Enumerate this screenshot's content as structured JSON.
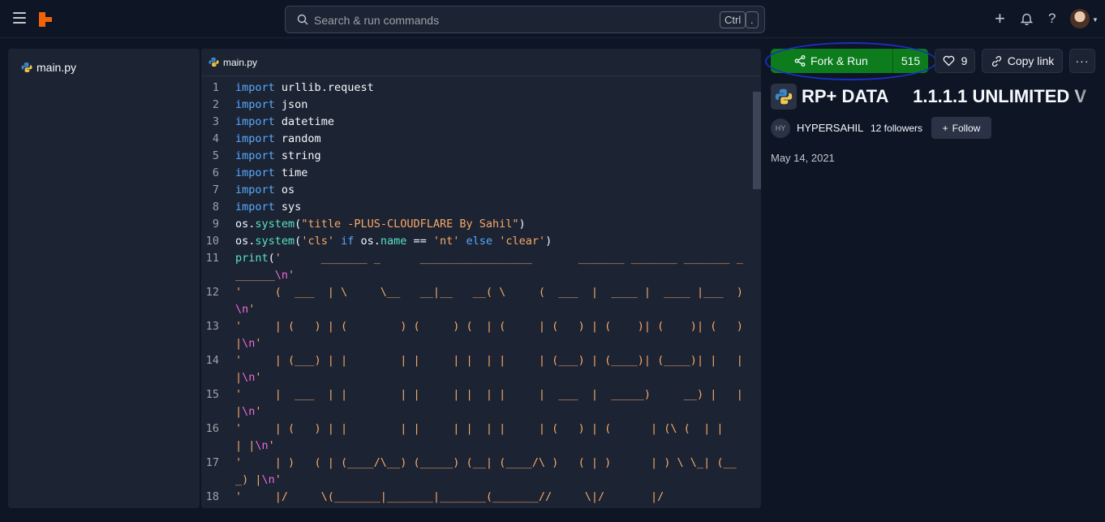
{
  "topbar": {
    "search_placeholder": "Search & run commands",
    "kbd_ctrl": "Ctrl",
    "kbd_dot": ".",
    "add_symbol": "+",
    "help_symbol": "?"
  },
  "filetree": {
    "file_name": "main.py"
  },
  "editor": {
    "tab_label": "main.py",
    "lines": [
      {
        "n": "1"
      },
      {
        "n": "2"
      },
      {
        "n": "3"
      },
      {
        "n": "4"
      },
      {
        "n": "5"
      },
      {
        "n": "6"
      },
      {
        "n": "7"
      },
      {
        "n": "8"
      },
      {
        "n": "9"
      },
      {
        "n": "10"
      },
      {
        "n": "11"
      },
      {
        "n": "12"
      },
      {
        "n": "13"
      },
      {
        "n": "14"
      },
      {
        "n": "15"
      },
      {
        "n": "16"
      },
      {
        "n": "17"
      },
      {
        "n": "18"
      }
    ],
    "code": {
      "l1": "urllib.request",
      "l2": "json",
      "l3": "datetime",
      "l4": "random",
      "l5": "string",
      "l6": "time",
      "l7": "os",
      "l8": "sys",
      "kw_import": "import",
      "l9_obj": "os.",
      "l9_fn": "system",
      "l9_open": "(",
      "l9_str": "\"title -PLUS-CLOUDFLARE By Sahil\"",
      "l9_close": ")",
      "l10_obj": "os.",
      "l10_fn": "system",
      "l10_open": "(",
      "l10_str1": "'cls'",
      "l10_if": " if ",
      "l10_mid": "os.",
      "l10_name": "name",
      "l10_eq": " == ",
      "l10_str2": "'nt'",
      "l10_else": " else ",
      "l10_str3": "'clear'",
      "l10_close": ")",
      "l11_fn": "print",
      "l11_open": "(",
      "l11_str": "'      _______ _      _________________       _______ _______ _______ _______",
      "l12_str": "'     (  ___  | \\     \\__   __|__   __( \\     (  ___  |  ____ |  ____ |___  )",
      "l13_str": "'     | (   ) | (        ) (     ) (  | (     | (   ) | (    )| (    )| (   ) |",
      "l14_str": "'     | (___) | |        | |     | |  | |     | (___) | (____)| (____)| |   | |",
      "l15_str": "'     |  ___  | |        | |     | |  | |     |  ___  |  _____)     __) |   | |",
      "l16_str": "'     | (   ) | |        | |     | |  | |     | (   ) | (      | (\\ (  | |   | |",
      "l17_str": "'     | )   ( | (____/\\__) (_____) (__| (____/\\ )   ( | )      | ) \\ \\_| (___) |",
      "l18_str": "'     |/     \\(_______|_______|_______(_______//     \\|/       |/",
      "esc_n": "\\n",
      "quote": "'"
    }
  },
  "panel": {
    "fork_label": "Fork & Run",
    "fork_count": "515",
    "like_count": "9",
    "copy_label": "Copy link",
    "more_label": "···",
    "title": "RP+ DATA     1.1.1.1 UNLIMITED V",
    "owner_initials": "HY",
    "owner_name": "HYPERSAHIL",
    "followers": "12 followers",
    "follow_label": "Follow",
    "follow_plus": "+",
    "date": "May 14, 2021"
  },
  "colors": {
    "background": "#0e1525",
    "surface": "#1c2333",
    "fork_green": "#0c7c1c",
    "keyword": "#57abff",
    "function": "#5be3bf",
    "string": "#f8a966",
    "escape": "#f06ad7",
    "logo_orange": "#f26207",
    "annotation_blue": "#1a2fbf"
  },
  "icons": {
    "menu": "hamburger-icon",
    "logo": "replit-logo",
    "search": "search-icon",
    "bell": "bell-icon",
    "python": "python-icon",
    "fork": "fork-icon",
    "heart": "heart-icon",
    "link": "link-icon"
  }
}
